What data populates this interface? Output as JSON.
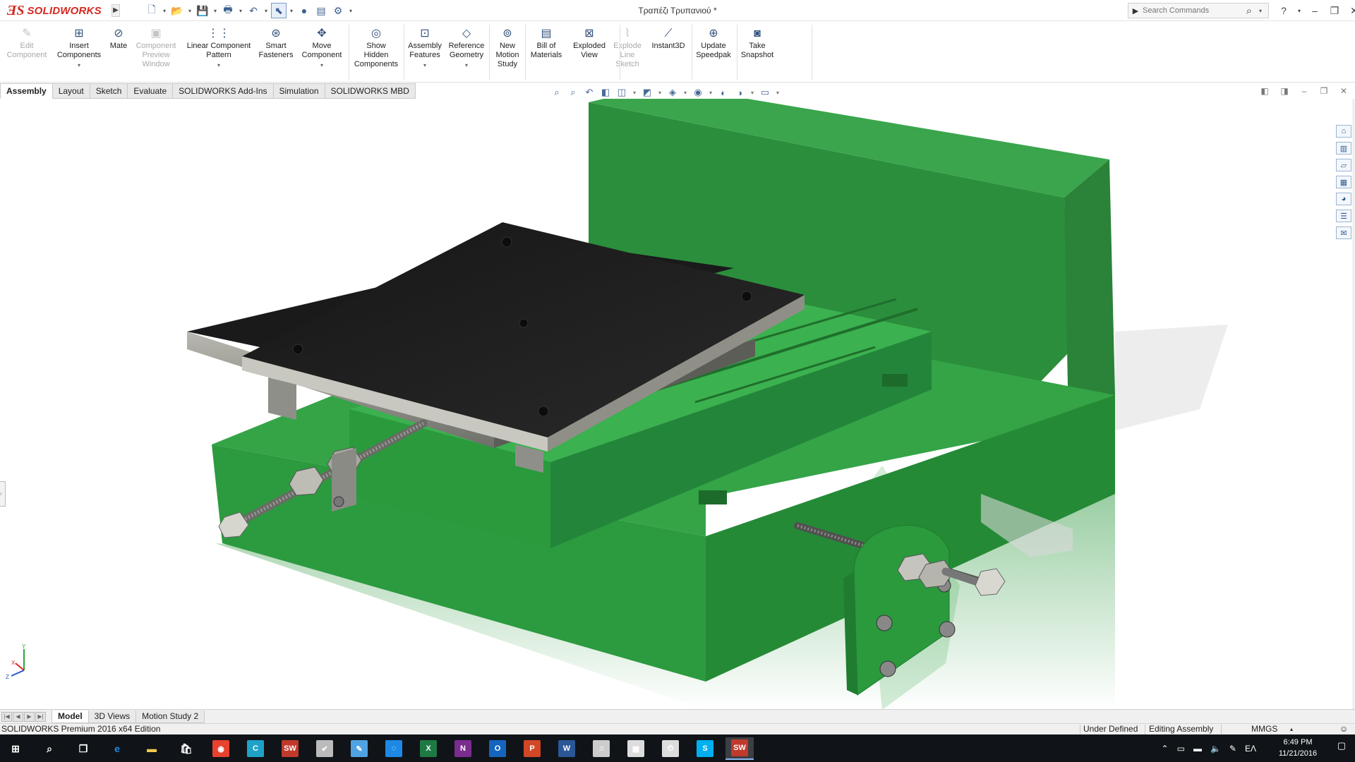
{
  "app": {
    "logo_mark": "ƎS",
    "logo_word": "SOLIDWORKS",
    "document_title": "Τραπέζι Τρυπανιού *",
    "search_placeholder": "Search Commands"
  },
  "ribbon": [
    {
      "label": "Edit Component",
      "lines": [
        "Edit",
        "Component"
      ],
      "enabled": false,
      "icon": "edit-component-icon"
    },
    {
      "label": "Insert Components",
      "lines": [
        "Insert",
        "Components"
      ],
      "enabled": true,
      "dropdown": true,
      "icon": "insert-components-icon"
    },
    {
      "label": "Mate",
      "lines": [
        "Mate"
      ],
      "enabled": true,
      "icon": "mate-icon"
    },
    {
      "label": "Component Preview Window",
      "lines": [
        "Component",
        "Preview",
        "Window"
      ],
      "enabled": false,
      "icon": "preview-window-icon"
    },
    {
      "label": "Linear Component Pattern",
      "lines": [
        "Linear Component",
        "Pattern"
      ],
      "enabled": true,
      "dropdown": true,
      "icon": "linear-pattern-icon"
    },
    {
      "label": "Smart Fasteners",
      "lines": [
        "Smart",
        "Fasteners"
      ],
      "enabled": true,
      "icon": "smart-fasteners-icon"
    },
    {
      "label": "Move Component",
      "lines": [
        "Move",
        "Component"
      ],
      "enabled": true,
      "dropdown": true,
      "icon": "move-component-icon"
    },
    {
      "label": "Show Hidden Components",
      "lines": [
        "Show",
        "Hidden",
        "Components"
      ],
      "enabled": true,
      "icon": "show-hidden-icon"
    },
    {
      "label": "Assembly Features",
      "lines": [
        "Assembly",
        "Features"
      ],
      "enabled": true,
      "dropdown": true,
      "icon": "assembly-features-icon"
    },
    {
      "label": "Reference Geometry",
      "lines": [
        "Reference",
        "Geometry"
      ],
      "enabled": true,
      "dropdown": true,
      "icon": "reference-geometry-icon"
    },
    {
      "label": "New Motion Study",
      "lines": [
        "New",
        "Motion",
        "Study"
      ],
      "enabled": true,
      "icon": "motion-study-icon"
    },
    {
      "label": "Bill of Materials",
      "lines": [
        "Bill of",
        "Materials"
      ],
      "enabled": true,
      "icon": "bill-of-materials-icon"
    },
    {
      "label": "Exploded View",
      "lines": [
        "Exploded",
        "View"
      ],
      "enabled": true,
      "icon": "exploded-view-icon"
    },
    {
      "label": "Explode Line Sketch",
      "lines": [
        "Explode",
        "Line",
        "Sketch"
      ],
      "enabled": false,
      "icon": "explode-line-icon"
    },
    {
      "label": "Instant3D",
      "lines": [
        "Instant3D"
      ],
      "enabled": true,
      "icon": "instant3d-icon"
    },
    {
      "label": "Update Speedpak",
      "lines": [
        "Update",
        "Speedpak"
      ],
      "enabled": true,
      "icon": "speedpak-icon"
    },
    {
      "label": "Take Snapshot",
      "lines": [
        "Take",
        "Snapshot"
      ],
      "enabled": true,
      "icon": "snapshot-icon"
    }
  ],
  "tabs": [
    "Assembly",
    "Layout",
    "Sketch",
    "Evaluate",
    "SOLIDWORKS Add-Ins",
    "Simulation",
    "SOLIDWORKS MBD"
  ],
  "active_tab": "Assembly",
  "bottom_tabs": [
    "Model",
    "3D Views",
    "Motion Study 2"
  ],
  "active_bottom_tab": "Model",
  "status": {
    "edition": "SOLIDWORKS Premium 2016 x64 Edition",
    "definition": "Under Defined",
    "mode": "Editing Assembly",
    "units": "MMGS"
  },
  "taskbar": {
    "language": "ΕΛ",
    "time": "6:49 PM",
    "date": "11/21/2016",
    "apps": [
      "start-icon",
      "search-icon",
      "task-view-icon",
      "edge-icon",
      "file-explorer-icon",
      "store-icon",
      "chrome-icon",
      "app-c-icon",
      "solidworks-2016-icon",
      "app-icon",
      "app-icon",
      "app-icon",
      "excel-icon",
      "onenote-icon",
      "outlook-icon",
      "powerpoint-icon",
      "word-icon",
      "itunes-icon",
      "calculator-icon",
      "app-icon",
      "skype-icon",
      "solidworks-2016-active-icon"
    ]
  },
  "colors": {
    "brand": "#d6281f",
    "base_green": "#2f9a41",
    "plate_black": "#1d1d1d",
    "rail_gray": "#8a8a84"
  }
}
